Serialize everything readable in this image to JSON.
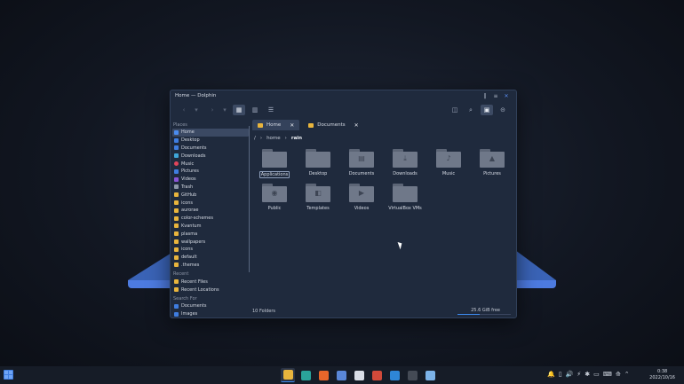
{
  "window": {
    "title": "Home — Dolphin",
    "controls": [
      "‖",
      "≡",
      "✕"
    ]
  },
  "toolbar": {
    "back": "‹",
    "back_menu": "▾",
    "forward": "›",
    "forward_menu": "▾",
    "view_icons": "▦",
    "view_compact": "▥",
    "view_details": "☰",
    "split": "◫",
    "search": "⌕",
    "preview": "▣",
    "menu": "⊝"
  },
  "sidebar": {
    "places_label": "Places",
    "places": [
      {
        "label": "Home",
        "icon": "home"
      },
      {
        "label": "Desktop",
        "icon": "blue"
      },
      {
        "label": "Documents",
        "icon": "blue"
      },
      {
        "label": "Downloads",
        "icon": "dl"
      },
      {
        "label": "Music",
        "icon": "music"
      },
      {
        "label": "Pictures",
        "icon": "blue"
      },
      {
        "label": "Videos",
        "icon": "vid"
      },
      {
        "label": "Trash",
        "icon": "trash"
      },
      {
        "label": "GitHub",
        "icon": "folder"
      },
      {
        "label": "icons",
        "icon": "folder"
      },
      {
        "label": "aurorae",
        "icon": "folder"
      },
      {
        "label": "color-schemes",
        "icon": "folder"
      },
      {
        "label": "Kvantum",
        "icon": "folder"
      },
      {
        "label": "plasma",
        "icon": "folder"
      },
      {
        "label": "wallpapers",
        "icon": "folder"
      },
      {
        "label": "icons",
        "icon": "folder"
      },
      {
        "label": "default",
        "icon": "folder"
      },
      {
        "label": ".themes",
        "icon": "folder"
      }
    ],
    "recent_label": "Recent",
    "recent": [
      {
        "label": "Recent Files",
        "icon": "rec"
      },
      {
        "label": "Recent Locations",
        "icon": "rec"
      }
    ],
    "search_label": "Search For",
    "search": [
      {
        "label": "Documents",
        "icon": "blue"
      },
      {
        "label": "Images",
        "icon": "blue"
      }
    ]
  },
  "tabs": [
    {
      "label": "Home",
      "close": "✕"
    },
    {
      "label": "Documents",
      "close": "✕"
    }
  ],
  "breadcrumb": {
    "root": "/",
    "sep": "›",
    "items": [
      "home",
      "rain"
    ]
  },
  "files": [
    {
      "label": "Applications",
      "glyph": ""
    },
    {
      "label": "Desktop",
      "glyph": ""
    },
    {
      "label": "Documents",
      "glyph": "▤"
    },
    {
      "label": "Downloads",
      "glyph": "⤓"
    },
    {
      "label": "Music",
      "glyph": "♪"
    },
    {
      "label": "Pictures",
      "glyph": "▲"
    },
    {
      "label": "Public",
      "glyph": "◉"
    },
    {
      "label": "Templates",
      "glyph": "◧"
    },
    {
      "label": "Videos",
      "glyph": "▶"
    },
    {
      "label": "VirtualBox VMs",
      "glyph": ""
    }
  ],
  "status": {
    "count": "10 Folders",
    "free": "25.6 GiB free",
    "used_fraction": 0.42
  },
  "taskbar": {
    "apps": [
      {
        "name": "dolphin-icon",
        "color": "#e9b53d",
        "active": true
      },
      {
        "name": "edge-icon",
        "color": "#2aa39a"
      },
      {
        "name": "firefox-icon",
        "color": "#e8662a"
      },
      {
        "name": "settings-icon",
        "color": "#5a87d8"
      },
      {
        "name": "github-icon",
        "color": "#d8dde6"
      },
      {
        "name": "app-icon",
        "color": "#d24a3a"
      },
      {
        "name": "vscode-icon",
        "color": "#2e86d6"
      },
      {
        "name": "inkscape-icon",
        "color": "#444a55"
      },
      {
        "name": "notes-icon",
        "color": "#7cb3e8"
      }
    ],
    "tray": [
      "🔔",
      "▯",
      "🔊",
      "⚡",
      "✱",
      "▭",
      "⌨",
      "⟰",
      "⌃"
    ],
    "time": "0:38",
    "date": "2022/10/16"
  }
}
